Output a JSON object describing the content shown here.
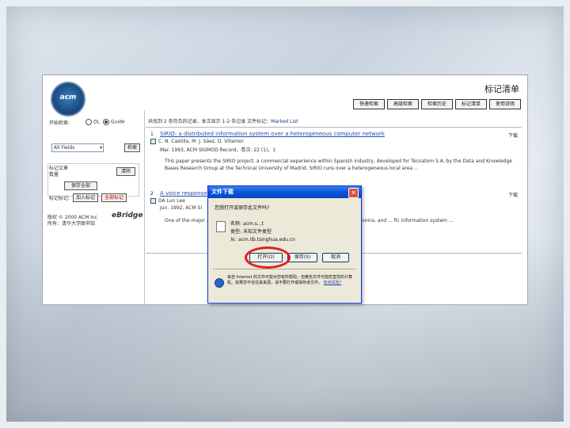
{
  "page": {
    "title": "标记清单"
  },
  "logo": {
    "text": "acm"
  },
  "toolbar": {
    "buttons": [
      "快速检索",
      "高级检索",
      "检索历史",
      "标记清单",
      "使用说明"
    ]
  },
  "left": {
    "search_label": "开始检索:",
    "radio_dl": "DL",
    "radio_guide": "Guide",
    "field_select": "All Fields",
    "search_button": "检索",
    "box_label": "标记文章\n数量",
    "clear_button": "清除",
    "save_button": "保存全部",
    "mark_label": "标记标记:",
    "add_button": "加入标记",
    "mark_all_button": "全部标记",
    "copyright": "版权 © 2000 ACM Inc",
    "rights": "所有：清华大学图书馆",
    "brand": "eBridge"
  },
  "results": {
    "summary": "共找到 2 条符合的记录，本次显示 1-2 条记录 文件标记：",
    "summary_link": "Marked List",
    "records": [
      {
        "num": "1",
        "title": "SIRIO: a distributed information system over a heterogeneous computer network",
        "authors": "C. N. Castilla, M. J. Sáez, D. Villamor",
        "source": "Mar. 1993, ACM SIGMOD Record，卷次: 22 (1)，1",
        "abstract": "This paper presents the SIRIO project, a commercial experience within Spanish industry, developed for Tecnatom S.A. by the Data and Knowledge Bases Research Group at the Technical University of Madrid. SIRIO runs over a heterogeneous local area ...",
        "side": "下载"
      },
      {
        "num": "2",
        "title": "A voice response",
        "authors": "DA Lun Lee",
        "source": "Jun. 1992, ACM SI",
        "abstract": "One of the major ... information exchange in different kinds of media such as text, voice, and ... fic information system ...",
        "side": "下载"
      }
    ]
  },
  "dialog": {
    "title": "文件下载",
    "question": "您想打开或保存此文件吗?",
    "name_label": "名称:",
    "name_value": "acm.s...t",
    "type_label": "类型:",
    "type_value": "未知文件类型",
    "from_label": "从:",
    "from_value": "acm.lib.tsinghua.edu.cn",
    "buttons": [
      "打开(O)",
      "保存(S)",
      "取消"
    ],
    "warning": "来自 Internet 的文件可能对您有所帮助，但某些文件可能危害您的计算机。如果您不信任其来源，请不要打开或保存该文件。",
    "warning_link": "有何风险?"
  }
}
